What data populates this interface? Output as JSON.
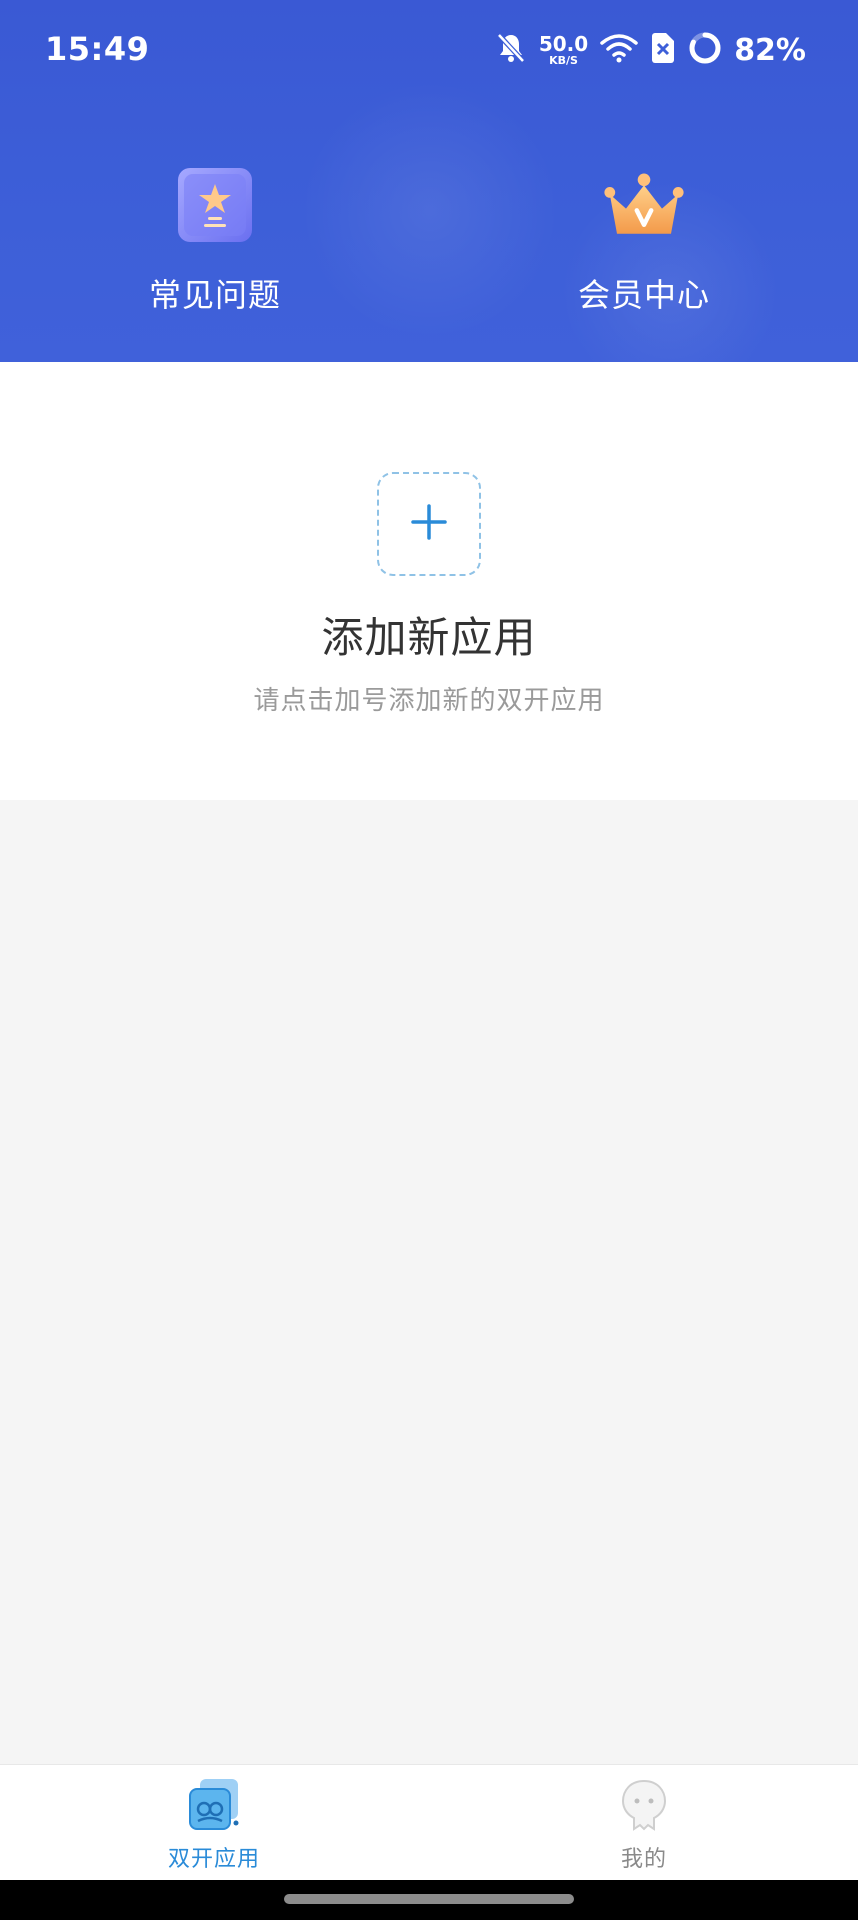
{
  "status_bar": {
    "time": "15:49",
    "net_speed_value": "50.0",
    "net_speed_unit": "KB/S",
    "battery_percent": "82%",
    "icons": [
      "mute-bell-icon",
      "wifi-icon",
      "sim-off-icon",
      "battery-ring-icon"
    ]
  },
  "header": {
    "shortcuts": [
      {
        "label": "常见问题",
        "icon": "faq-trophy-icon"
      },
      {
        "label": "会员中心",
        "icon": "crown-icon"
      }
    ]
  },
  "add_app": {
    "icon": "plus-icon",
    "title": "添加新应用",
    "subtitle": "请点击加号添加新的双开应用"
  },
  "bottom_nav": {
    "items": [
      {
        "label": "双开应用",
        "icon": "dual-app-icon",
        "active": true
      },
      {
        "label": "我的",
        "icon": "profile-ghost-icon",
        "active": false
      }
    ]
  },
  "colors": {
    "header_blue": "#3d5fd8",
    "accent_blue": "#2a8bd8",
    "dashed_border": "#8fc2e6",
    "background": "#f5f5f5"
  }
}
